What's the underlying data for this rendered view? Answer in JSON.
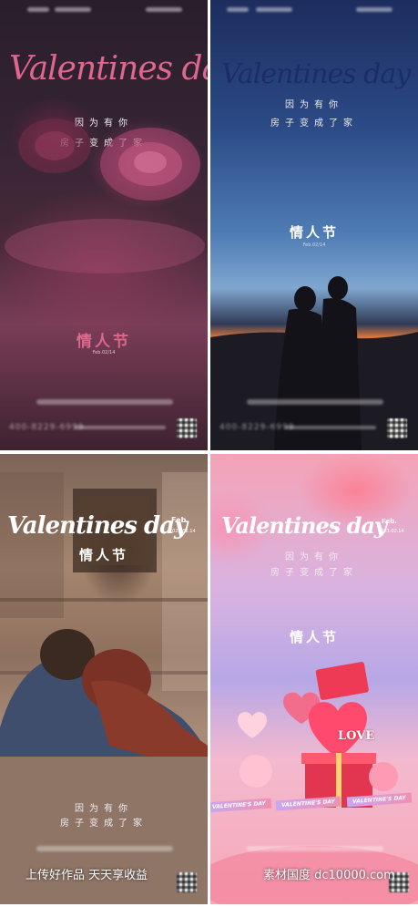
{
  "panels": [
    {
      "title": "Valentines day",
      "subtitle1": "因为有你",
      "subtitle2": "房子变成了家",
      "festival": "情人节",
      "date": "Feb.02/14"
    },
    {
      "title": "Valentines day",
      "subtitle1": "因为有你",
      "subtitle2": "房子变成了家",
      "festival": "情人节",
      "date": "Feb.02/14"
    },
    {
      "title": "Valentines day",
      "badge_month": "Feb.",
      "badge_date": "2023.02.14",
      "festival": "情人节",
      "subtitle1": "因为有你",
      "subtitle2": "房子变成了家"
    },
    {
      "title": "Valentines day",
      "badge_month": "Feb.",
      "badge_date": "2023.02.14",
      "subtitle1": "因为有你",
      "subtitle2": "房子变成了家",
      "festival": "情人节",
      "ribbon": "VALENTINE'S DAY",
      "love": "LOVE"
    }
  ],
  "watermarks": {
    "left": "上传好作品 天天享收益",
    "right": "素材国度 dc10000.com"
  },
  "colors": {
    "title1": "#e0668c",
    "title2": "#1a2a66",
    "festival1": "#e0668c",
    "white": "#ffffff"
  }
}
